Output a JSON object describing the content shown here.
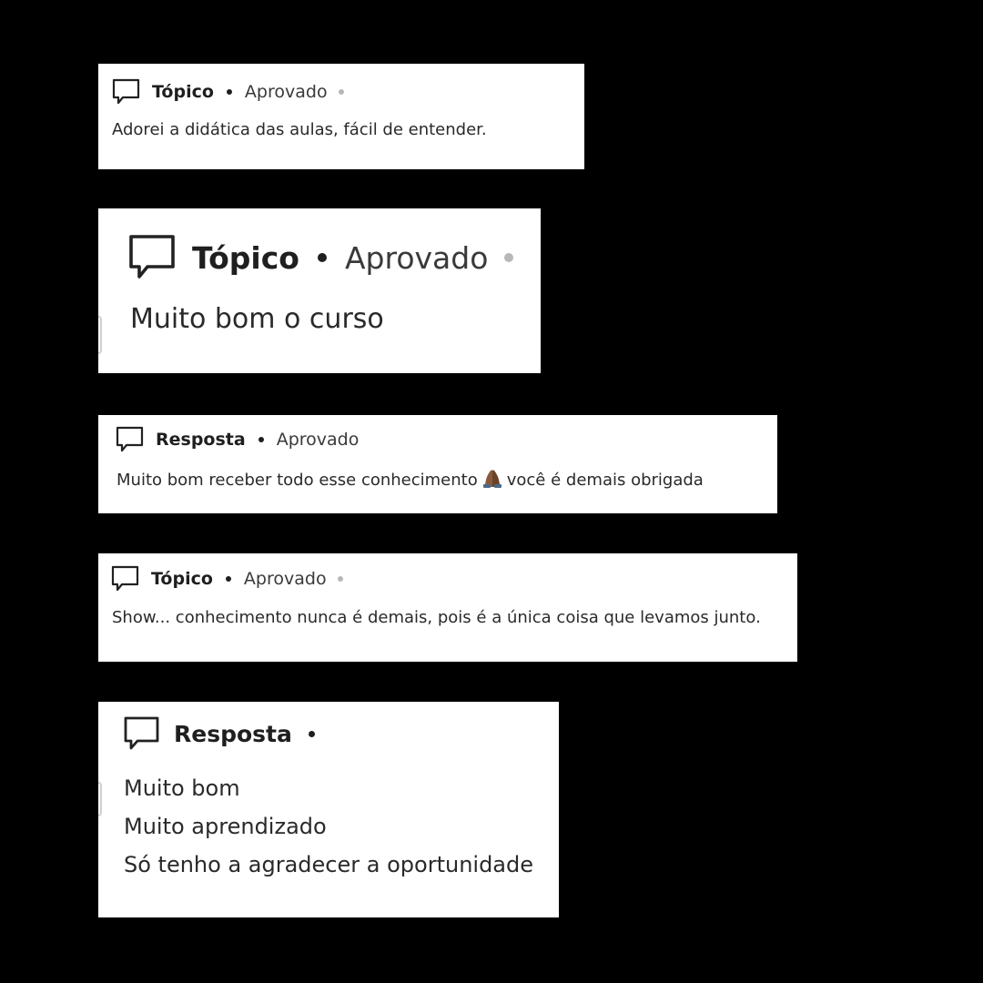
{
  "comments": [
    {
      "type": "Tópico",
      "status": "Aprovado",
      "text_lines": [
        "Adorei a didática das aulas, fácil de entender."
      ]
    },
    {
      "type": "Tópico",
      "status": "Aprovado",
      "text_lines": [
        "Muito bom o curso"
      ]
    },
    {
      "type": "Resposta",
      "status": "Aprovado",
      "text_before_emoji": "Muito bom receber todo esse conhecimento",
      "emoji": "praying-hands-emoji",
      "text_after_emoji": "você é demais obrigada"
    },
    {
      "type": "Tópico",
      "status": "Aprovado",
      "text_lines": [
        "Show... conhecimento nunca é demais, pois é a única coisa que levamos junto."
      ]
    },
    {
      "type": "Resposta",
      "text_lines": [
        "Muito bom",
        "Muito aprendizado",
        "Só tenho a agradecer a oportunidade"
      ]
    }
  ],
  "icons": {
    "comment": "speech-bubble-icon"
  },
  "colors": {
    "background": "#000000",
    "card": "#ffffff",
    "text": "#222222",
    "muted_dot": "#b8b8b8"
  }
}
